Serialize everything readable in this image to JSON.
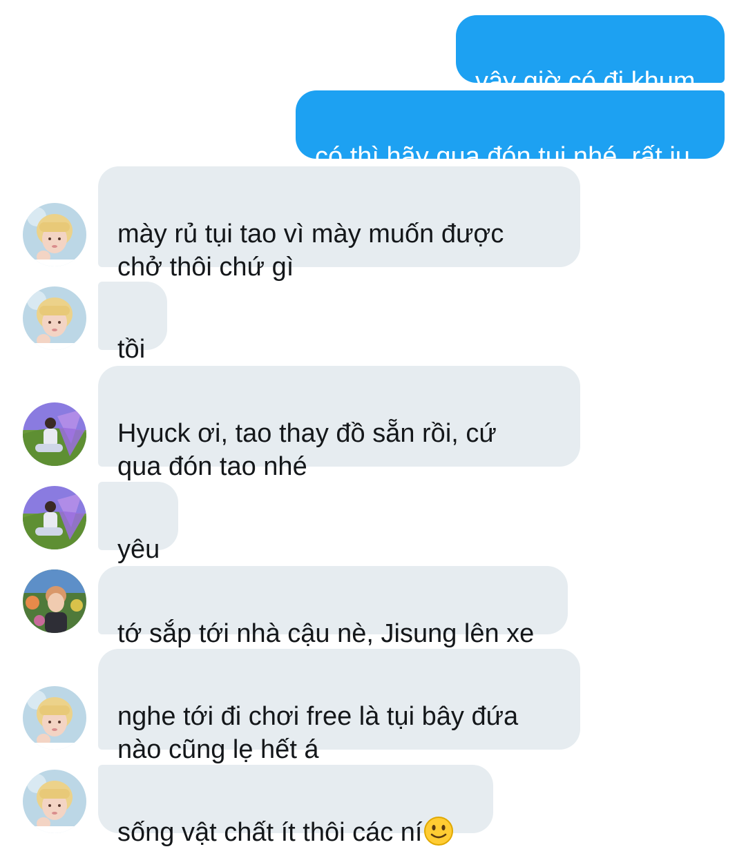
{
  "conversation": {
    "messages": [
      {
        "sender": "me",
        "text": "vậy giờ có đi khum"
      },
      {
        "sender": "me",
        "text": "có thì hãy qua đón tui nhé, rất iu"
      },
      {
        "sender": "friend-blond",
        "text": "mày rủ tụi tao vì mày muốn được\nchở thôi chứ gì"
      },
      {
        "sender": "friend-blond",
        "text": "tồi"
      },
      {
        "sender": "friend-fairy",
        "text": "Hyuck ơi, tao thay đồ sẵn rồi, cứ\nqua đón tao nhé"
      },
      {
        "sender": "friend-fairy",
        "text": "yêu"
      },
      {
        "sender": "friend-garden",
        "text": "tớ sắp tới nhà cậu nè, Jisung lên xe"
      },
      {
        "sender": "friend-blond",
        "text": "nghe tới đi chơi free là tụi bây đứa\nnào cũng lẹ hết á"
      },
      {
        "sender": "friend-blond",
        "text": "sống vật chất ít thôi các ní",
        "emoji": "slightly-smiling-face"
      }
    ]
  },
  "colors": {
    "outgoing_bubble": "#1da1f2",
    "incoming_bubble": "#e6ecf0",
    "incoming_text": "#14171a"
  }
}
